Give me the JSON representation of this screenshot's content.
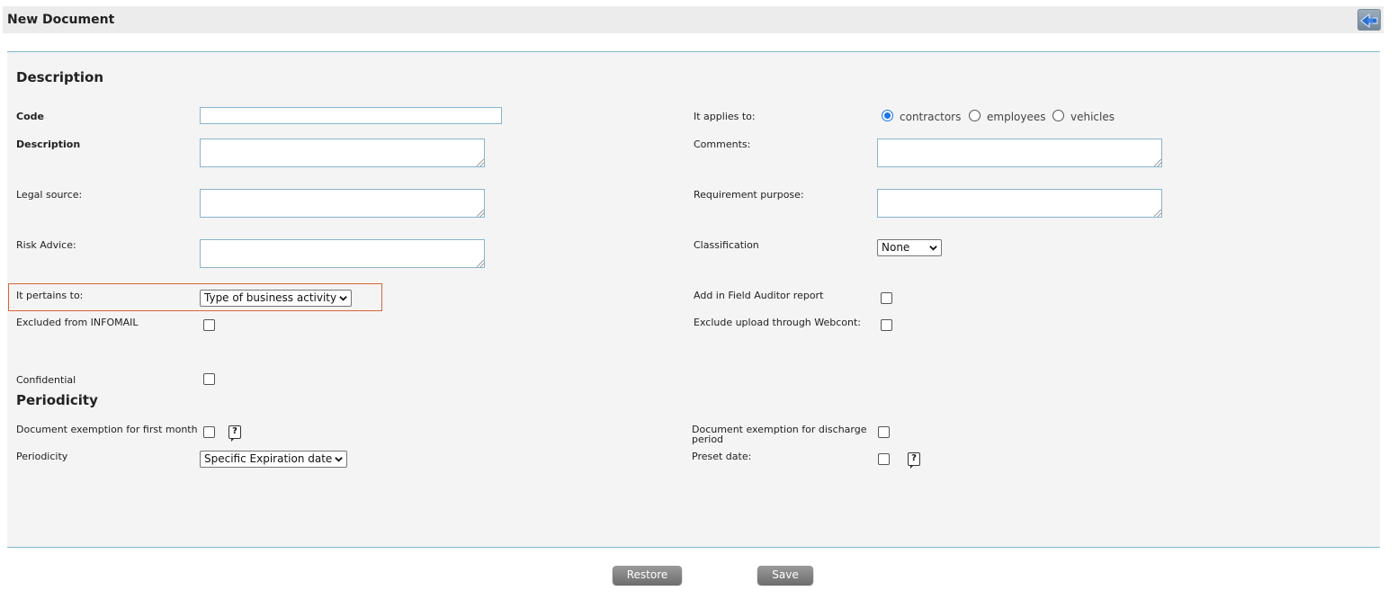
{
  "window": {
    "title": "New Document"
  },
  "sections": {
    "description": "Description",
    "periodicity": "Periodicity"
  },
  "fields": {
    "code": {
      "label": "Code",
      "value": ""
    },
    "description": {
      "label": "Description",
      "value": ""
    },
    "legal_source": {
      "label": "Legal source:",
      "value": ""
    },
    "risk_advice": {
      "label": "Risk Advice:",
      "value": ""
    },
    "pertains_to": {
      "label": "It pertains to:",
      "selected": "Type of business activity"
    },
    "excluded_infomail": {
      "label": "Excluded from INFOMAIL",
      "checked": false
    },
    "confidential": {
      "label": "Confidential",
      "checked": false
    },
    "applies_to": {
      "label": "It applies to:",
      "options": [
        "contractors",
        "employees",
        "vehicles"
      ],
      "selected": "contractors"
    },
    "comments": {
      "label": "Comments:",
      "value": ""
    },
    "requirement_purpose": {
      "label": "Requirement purpose:",
      "value": ""
    },
    "classification": {
      "label": "Classification",
      "selected": "None"
    },
    "field_auditor": {
      "label": "Add in Field Auditor report",
      "checked": false
    },
    "exclude_webcont": {
      "label": "Exclude upload through Webcont:",
      "checked": false
    }
  },
  "periodicity": {
    "first_month": {
      "label": "Document exemption for first month",
      "checked": false
    },
    "periodicity": {
      "label": "Periodicity",
      "selected": "Specific Expiration date"
    },
    "discharge": {
      "label": "Document exemption for discharge period",
      "checked": false
    },
    "preset_date": {
      "label": "Preset date:",
      "checked": false
    },
    "help_glyph": "?"
  },
  "buttons": {
    "restore": "Restore",
    "save": "Save"
  },
  "icons": {
    "back": "double-arrow-left-icon",
    "help": "help-bubble-icon"
  },
  "colors": {
    "accent_border": "#88b4cc",
    "highlight": "#d9653b",
    "radio_selected": "#1a73e8"
  }
}
